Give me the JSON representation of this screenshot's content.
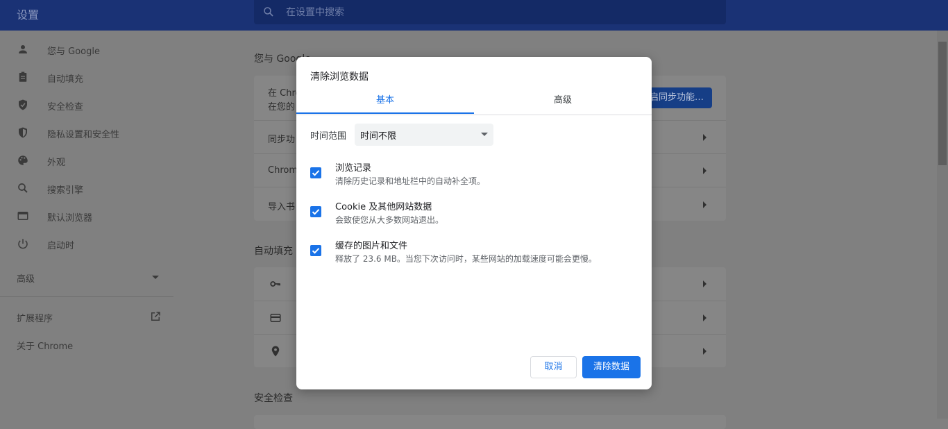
{
  "header": {
    "title": "设置",
    "search_placeholder": "在设置中搜索"
  },
  "sidebar": {
    "items": [
      {
        "label": "您与 Google",
        "icon": "person-icon"
      },
      {
        "label": "自动填充",
        "icon": "clipboard-icon"
      },
      {
        "label": "安全检查",
        "icon": "shield-check-icon"
      },
      {
        "label": "隐私设置和安全性",
        "icon": "shield-icon"
      },
      {
        "label": "外观",
        "icon": "palette-icon"
      },
      {
        "label": "搜索引擎",
        "icon": "search-icon"
      },
      {
        "label": "默认浏览器",
        "icon": "browser-icon"
      },
      {
        "label": "启动时",
        "icon": "power-icon"
      }
    ],
    "advanced_label": "高级",
    "extensions_label": "扩展程序",
    "about_label": "关于 Chrome"
  },
  "main": {
    "you_google_title": "您与 Google",
    "sync_row_line1": "在 Chro",
    "sync_row_line2": "在您的",
    "sync_button": "启同步功能…",
    "rows": [
      "同步功",
      "Chrome",
      "导入书"
    ],
    "autofill_title": "自动填充",
    "safety_title": "安全检查"
  },
  "dialog": {
    "title": "清除浏览数据",
    "tabs": {
      "basic": "基本",
      "advanced": "高级"
    },
    "time_range_label": "时间范围",
    "time_range_value": "时间不限",
    "options": [
      {
        "title": "浏览记录",
        "desc": "清除历史记录和地址栏中的自动补全项。",
        "checked": true
      },
      {
        "title": "Cookie 及其他网站数据",
        "desc": "会致使您从大多数网站退出。",
        "checked": true
      },
      {
        "title": "缓存的图片和文件",
        "desc": "释放了 23.6 MB。当您下次访问时，某些网站的加载速度可能会更慢。",
        "checked": true
      }
    ],
    "cancel_label": "取消",
    "clear_label": "清除数据"
  },
  "colors": {
    "accent": "#1a73e8",
    "topbar_dimmed": "#1a3275",
    "overlay": "#808080"
  }
}
